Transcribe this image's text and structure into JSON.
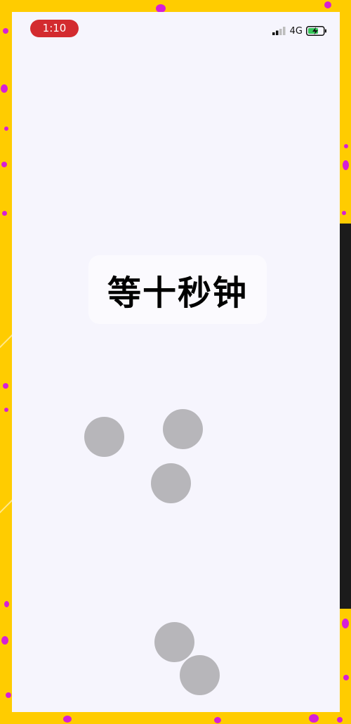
{
  "status_bar": {
    "time": "1:10",
    "network": "4G",
    "icons": [
      "signal-icon",
      "battery-charging-icon"
    ]
  },
  "main": {
    "title": "等十秒钟",
    "circle_count": 5
  },
  "colors": {
    "frame": "#ffcc00",
    "speckle": "#d61fd6",
    "screen_bg": "#f6f5fd",
    "time_pill": "#d32b2f",
    "circle": "#b7b6ba",
    "battery_fill": "#35c759"
  }
}
